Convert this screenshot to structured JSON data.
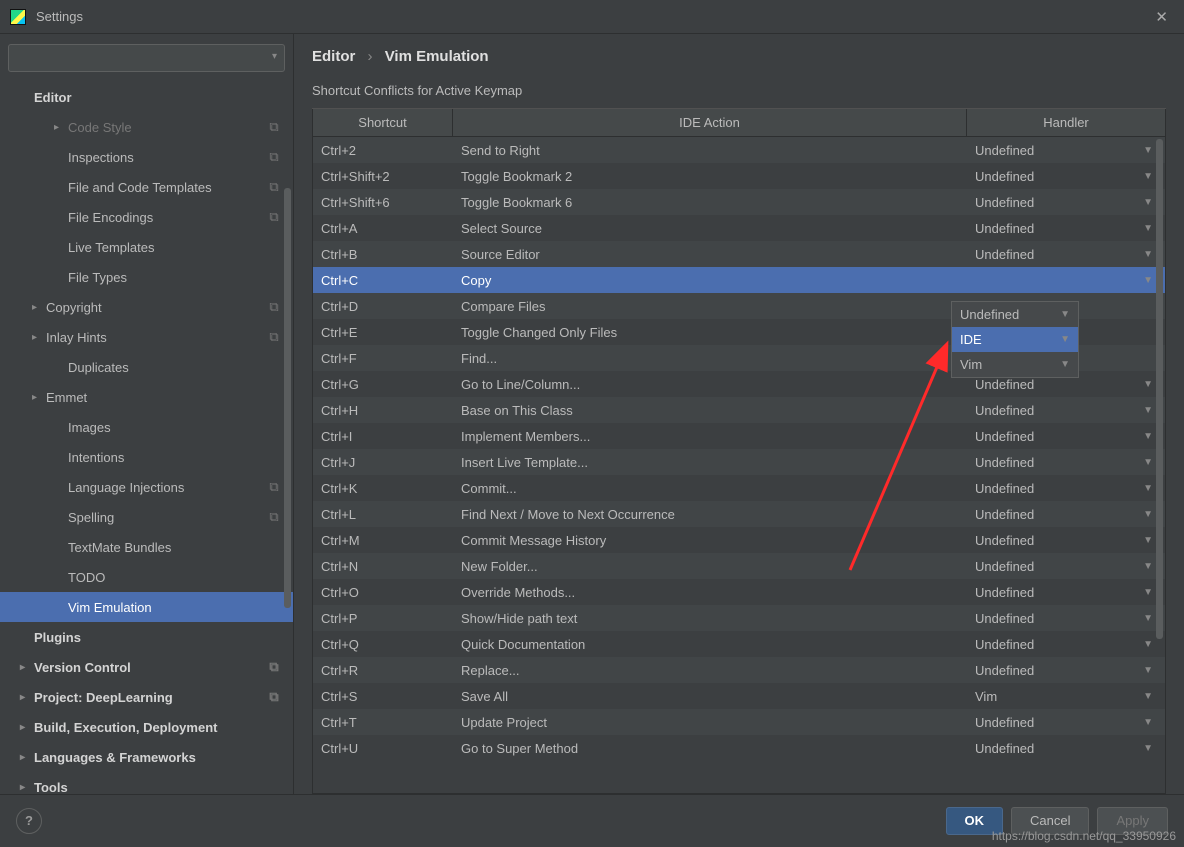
{
  "window": {
    "title": "Settings"
  },
  "search": {
    "placeholder": ""
  },
  "sidebar": {
    "items": [
      {
        "label": "Editor",
        "bold": true,
        "indent": 0,
        "arrow": "",
        "badge": ""
      },
      {
        "label": "Code Style",
        "indent": 2,
        "arrow": "▸",
        "badge": "⧉",
        "dim": true
      },
      {
        "label": "Inspections",
        "indent": 2,
        "arrow": "",
        "badge": "⧉"
      },
      {
        "label": "File and Code Templates",
        "indent": 2,
        "arrow": "",
        "badge": "⧉"
      },
      {
        "label": "File Encodings",
        "indent": 2,
        "arrow": "",
        "badge": "⧉"
      },
      {
        "label": "Live Templates",
        "indent": 2,
        "arrow": "",
        "badge": ""
      },
      {
        "label": "File Types",
        "indent": 2,
        "arrow": "",
        "badge": ""
      },
      {
        "label": "Copyright",
        "indent": 1,
        "arrow": "▸",
        "badge": "⧉"
      },
      {
        "label": "Inlay Hints",
        "indent": 1,
        "arrow": "▸",
        "badge": "⧉"
      },
      {
        "label": "Duplicates",
        "indent": 2,
        "arrow": "",
        "badge": ""
      },
      {
        "label": "Emmet",
        "indent": 1,
        "arrow": "▸",
        "badge": ""
      },
      {
        "label": "Images",
        "indent": 2,
        "arrow": "",
        "badge": ""
      },
      {
        "label": "Intentions",
        "indent": 2,
        "arrow": "",
        "badge": ""
      },
      {
        "label": "Language Injections",
        "indent": 2,
        "arrow": "",
        "badge": "⧉"
      },
      {
        "label": "Spelling",
        "indent": 2,
        "arrow": "",
        "badge": "⧉"
      },
      {
        "label": "TextMate Bundles",
        "indent": 2,
        "arrow": "",
        "badge": ""
      },
      {
        "label": "TODO",
        "indent": 2,
        "arrow": "",
        "badge": ""
      },
      {
        "label": "Vim Emulation",
        "indent": 2,
        "arrow": "",
        "badge": "",
        "selected": true
      },
      {
        "label": "Plugins",
        "bold": true,
        "indent": 0,
        "arrow": "",
        "badge": ""
      },
      {
        "label": "Version Control",
        "bold": true,
        "indent": 0,
        "arrow": "▸",
        "badge": "⧉"
      },
      {
        "label": "Project: DeepLearning",
        "bold": true,
        "indent": 0,
        "arrow": "▸",
        "badge": "⧉"
      },
      {
        "label": "Build, Execution, Deployment",
        "bold": true,
        "indent": 0,
        "arrow": "▸",
        "badge": ""
      },
      {
        "label": "Languages & Frameworks",
        "bold": true,
        "indent": 0,
        "arrow": "▸",
        "badge": ""
      },
      {
        "label": "Tools",
        "bold": true,
        "indent": 0,
        "arrow": "▸",
        "badge": ""
      }
    ]
  },
  "breadcrumb": {
    "root": "Editor",
    "leaf": "Vim Emulation"
  },
  "section": {
    "title": "Shortcut Conflicts for Active Keymap"
  },
  "table": {
    "headers": {
      "shortcut": "Shortcut",
      "action": "IDE Action",
      "handler": "Handler"
    },
    "rows": [
      {
        "shortcut": "Ctrl+2",
        "action": "Send to Right",
        "handler": "Undefined"
      },
      {
        "shortcut": "Ctrl+Shift+2",
        "action": "Toggle Bookmark 2",
        "handler": "Undefined"
      },
      {
        "shortcut": "Ctrl+Shift+6",
        "action": "Toggle Bookmark 6",
        "handler": "Undefined"
      },
      {
        "shortcut": "Ctrl+A",
        "action": "Select Source",
        "handler": "Undefined"
      },
      {
        "shortcut": "Ctrl+B",
        "action": "Source Editor",
        "handler": "Undefined"
      },
      {
        "shortcut": "Ctrl+C",
        "action": "Copy",
        "handler": "",
        "selected": true
      },
      {
        "shortcut": "Ctrl+D",
        "action": "Compare Files",
        "handler": "Undefined"
      },
      {
        "shortcut": "Ctrl+E",
        "action": "Toggle Changed Only Files",
        "handler": "IDE"
      },
      {
        "shortcut": "Ctrl+F",
        "action": "Find...",
        "handler": "Vim"
      },
      {
        "shortcut": "Ctrl+G",
        "action": "Go to Line/Column...",
        "handler": "Undefined"
      },
      {
        "shortcut": "Ctrl+H",
        "action": "Base on This Class",
        "handler": "Undefined"
      },
      {
        "shortcut": "Ctrl+I",
        "action": "Implement Members...",
        "handler": "Undefined"
      },
      {
        "shortcut": "Ctrl+J",
        "action": "Insert Live Template...",
        "handler": "Undefined"
      },
      {
        "shortcut": "Ctrl+K",
        "action": "Commit...",
        "handler": "Undefined"
      },
      {
        "shortcut": "Ctrl+L",
        "action": "Find Next / Move to Next Occurrence",
        "handler": "Undefined"
      },
      {
        "shortcut": "Ctrl+M",
        "action": "Commit Message History",
        "handler": "Undefined"
      },
      {
        "shortcut": "Ctrl+N",
        "action": "New Folder...",
        "handler": "Undefined"
      },
      {
        "shortcut": "Ctrl+O",
        "action": "Override Methods...",
        "handler": "Undefined"
      },
      {
        "shortcut": "Ctrl+P",
        "action": "Show/Hide path text",
        "handler": "Undefined"
      },
      {
        "shortcut": "Ctrl+Q",
        "action": "Quick Documentation",
        "handler": "Undefined"
      },
      {
        "shortcut": "Ctrl+R",
        "action": "Replace...",
        "handler": "Undefined"
      },
      {
        "shortcut": "Ctrl+S",
        "action": "Save All",
        "handler": "Vim"
      },
      {
        "shortcut": "Ctrl+T",
        "action": "Update Project",
        "handler": "Undefined"
      },
      {
        "shortcut": "Ctrl+U",
        "action": "Go to Super Method",
        "handler": "Undefined"
      }
    ]
  },
  "dropdown": {
    "options": [
      {
        "label": "Undefined"
      },
      {
        "label": "IDE",
        "selected": true
      },
      {
        "label": "Vim"
      }
    ]
  },
  "footer": {
    "ok": "OK",
    "cancel": "Cancel",
    "apply": "Apply"
  },
  "watermark": "https://blog.csdn.net/qq_33950926"
}
